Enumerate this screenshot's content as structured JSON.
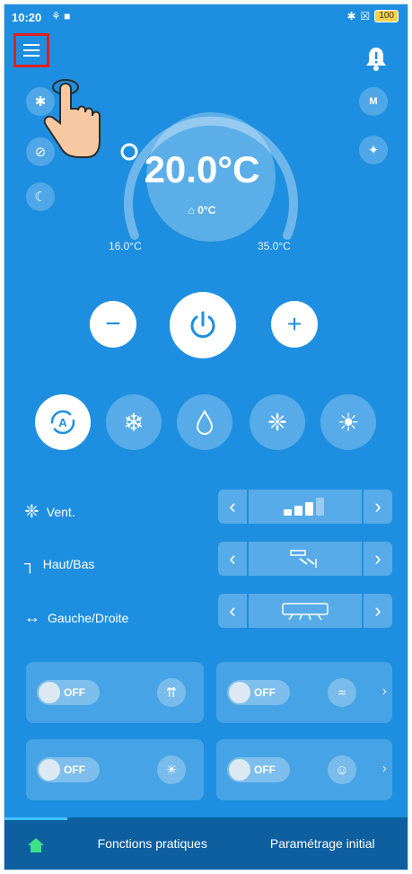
{
  "statusbar": {
    "time": "10:20",
    "left_icons": "⚘ ■",
    "bluetooth_icon": "bluetooth-icon",
    "battery": "100"
  },
  "header": {
    "menu_icon": "hamburger-menu-icon",
    "notification_icon": "bell-icon"
  },
  "side_buttons": [
    {
      "icon": "bluetooth-icon",
      "glyph": "✱"
    },
    {
      "icon": "eco-leaf-off-icon",
      "glyph": "⊘"
    },
    {
      "icon": "sleep-moon-icon",
      "glyph": "☾"
    }
  ],
  "right_buttons": [
    {
      "icon": "schedule-icon",
      "glyph": "M"
    },
    {
      "icon": "expand-icon",
      "glyph": "✦"
    }
  ],
  "temperature": {
    "set_point": "20.0°C",
    "indoor": "0°C",
    "min": "16.0°C",
    "max": "35.0°C"
  },
  "controls": {
    "minus": "−",
    "plus": "+",
    "power_icon": "power-icon"
  },
  "modes": [
    {
      "name": "auto",
      "icon": "auto-mode-icon",
      "active": true
    },
    {
      "name": "cool",
      "icon": "snowflake-icon",
      "active": false
    },
    {
      "name": "dry",
      "icon": "droplet-icon",
      "active": false
    },
    {
      "name": "fan",
      "icon": "fan-icon",
      "active": false
    },
    {
      "name": "heat",
      "icon": "sun-icon",
      "active": false
    }
  ],
  "settings": {
    "fan": {
      "label": "Vent.",
      "level": 3,
      "max_level": 4
    },
    "vertical": {
      "label": "Haut/Bas"
    },
    "horizontal": {
      "label": "Gauche/Droite"
    }
  },
  "cards": [
    {
      "toggle": "OFF",
      "icon": "turbo-icon",
      "has_chevron": false
    },
    {
      "toggle": "OFF",
      "icon": "airflow-icon",
      "has_chevron": true
    },
    {
      "toggle": "OFF",
      "icon": "lightbulb-icon",
      "has_chevron": false
    },
    {
      "toggle": "OFF",
      "icon": "person-sensor-icon",
      "has_chevron": true
    }
  ],
  "bottom_nav": {
    "home_icon": "home-icon",
    "tab_functions": "Fonctions pratiques",
    "tab_settings": "Paramétrage initial"
  },
  "colors": {
    "background": "#1e8fe0",
    "nav": "#0d5fa0",
    "highlight": "#e02020"
  }
}
